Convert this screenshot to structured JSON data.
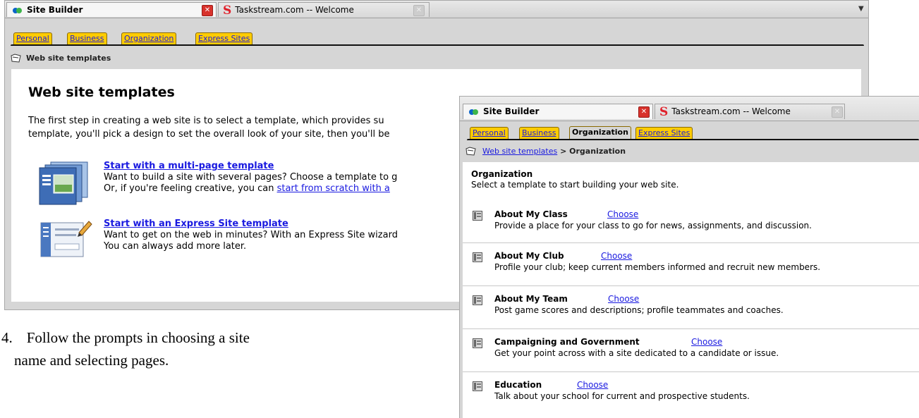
{
  "window1": {
    "tabs": [
      {
        "label": "Site Builder",
        "active": true
      },
      {
        "label": "Taskstream.com -- Welcome",
        "active": false
      }
    ],
    "site_tabs": [
      "Personal",
      "Business",
      "Organization",
      "Express Sites"
    ],
    "breadcrumb": "Web site templates",
    "heading": "Web site templates",
    "intro_line1": "The first step in creating a web site is to select a template, which provides su",
    "intro_line2": "template, you'll pick a design to set the overall look of your site, then you'll be",
    "options": [
      {
        "title": "Start with a multi-page template",
        "desc_line1": "Want to build a site with several pages? Choose a template to g",
        "desc_line2_prefix": "Or, if you're feeling creative, you can ",
        "desc_line2_link": "start from scratch with a",
        "icon": "multi-page-template-icon"
      },
      {
        "title": "Start with an Express Site template",
        "desc_line1": "Want to get on the web in minutes? With an Express Site wizard",
        "desc_line2": "You can always add more later.",
        "icon": "express-site-template-icon"
      }
    ]
  },
  "window2": {
    "tabs": [
      {
        "label": "Site Builder",
        "active": true
      },
      {
        "label": "Taskstream.com -- Welcome",
        "active": false
      }
    ],
    "site_tabs": [
      "Personal",
      "Business",
      "Organization",
      "Express Sites"
    ],
    "selected_tab": "Organization",
    "breadcrumb_link": "Web site templates",
    "breadcrumb_sep": ">",
    "breadcrumb_current": "Organization",
    "heading": "Organization",
    "subheading": "Select a template to start building your web site.",
    "choose_label": "Choose",
    "templates": [
      {
        "name": "About My Class",
        "desc": "Provide a place for your class to go for news, assignments, and discussion."
      },
      {
        "name": "About My Club",
        "desc": "Profile your club; keep current members informed and recruit new members."
      },
      {
        "name": "About My Team",
        "desc": "Post game scores and descriptions; profile teammates and coaches."
      },
      {
        "name": "Campaigning and Government",
        "desc": "Get your point across with a site dedicated to a candidate or issue."
      },
      {
        "name": "Education",
        "desc": "Talk about your school for current and prospective students."
      }
    ]
  },
  "document": {
    "step_number": "4.",
    "step_line1": "Follow the prompts in choosing a site",
    "step_line2": "name and selecting pages."
  },
  "colors": {
    "site_tab": "#ffcc00",
    "chrome": "#d6d6d6",
    "link": "#1a1ae0",
    "close_red": "#d8322c"
  }
}
